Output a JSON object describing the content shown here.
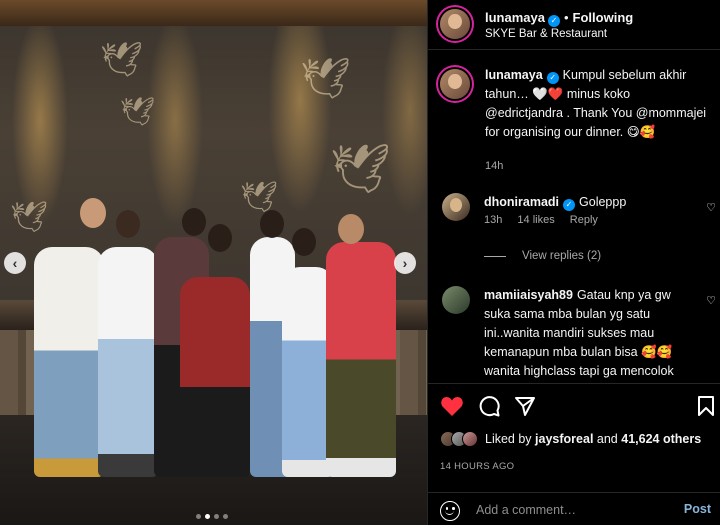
{
  "post": {
    "username": "lunamaya",
    "follow_status": "Following",
    "separator": "•",
    "location": "SKYE Bar & Restaurant"
  },
  "caption": {
    "username": "lunamaya",
    "text": "Kumpul sebelum akhir tahun… 🤍❤️ minus koko @edrictjandra . Thank You @mommajei for organising our dinner. 😋🥰",
    "time": "14h"
  },
  "comments": [
    {
      "username": "dhoniramadi",
      "verified": true,
      "text": "Goleppp",
      "time": "13h",
      "likes": "14 likes",
      "reply_label": "Reply",
      "view_replies": "View replies (2)"
    },
    {
      "username": "mamiiaisyah89",
      "verified": false,
      "text": "Gatau knp ya gw suka sama mba bulan yg satu ini..wanita mandiri sukses mau kemanapun mba bulan bisa 🥰🥰 wanita highclass tapi ga mencolok dan ga pernah nyombongin dgn apa"
    }
  ],
  "likes": {
    "prefix": "Liked by",
    "user": "jaysforeal",
    "middle": "and",
    "count": "41,624 others"
  },
  "post_time": "14 HOURS AGO",
  "add_comment": {
    "placeholder": "Add a comment…",
    "post_label": "Post"
  },
  "carousel": {
    "prev_icon": "‹",
    "next_icon": "›",
    "dots": 4,
    "active_dot": 1
  },
  "icons": {
    "like": "heart-filled-icon",
    "comment": "comment-icon",
    "share": "share-icon",
    "save": "bookmark-icon"
  },
  "colors": {
    "like_red": "#ff3040",
    "verified_blue": "#0095f6",
    "post_button": "#8ab4d8"
  }
}
